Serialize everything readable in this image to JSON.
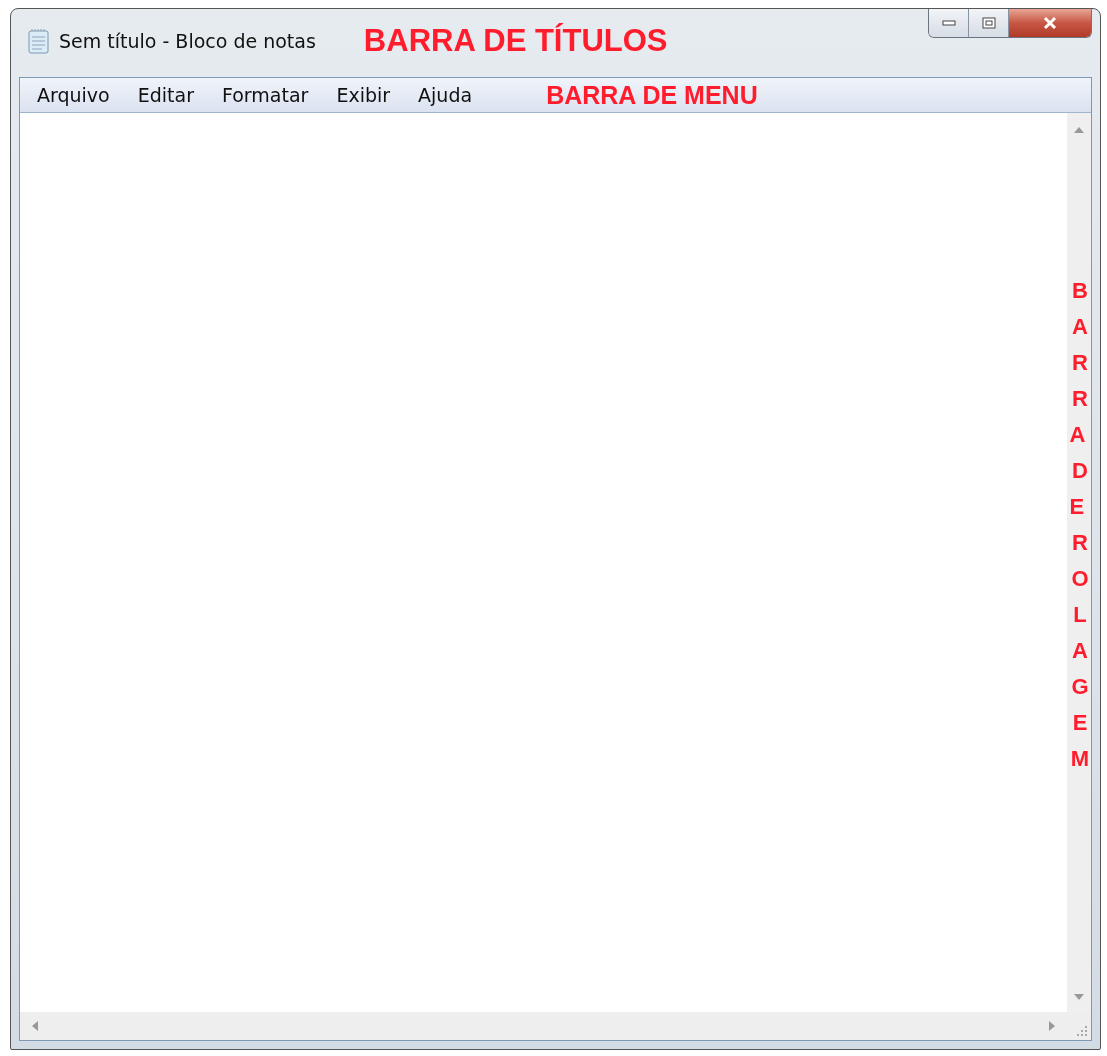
{
  "window": {
    "title": "Sem título - Bloco de notas"
  },
  "annotations": {
    "title_bar": "BARRA DE TÍTULOS",
    "menu_bar": "BARRA DE MENU",
    "scroll_bar": "BARRA DE ROLAGEM"
  },
  "menu": [
    "Arquivo",
    "Editar",
    "Formatar",
    "Exibir",
    "Ajuda"
  ]
}
